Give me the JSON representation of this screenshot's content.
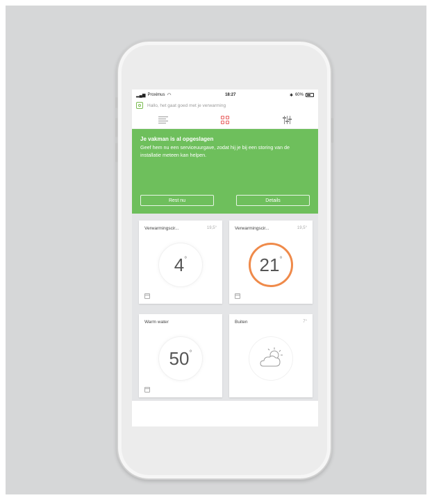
{
  "status": {
    "carrier": "Proximus",
    "time": "18:27",
    "battery": "60%"
  },
  "greeting": "Hallo, het gaat goed met je verwarming",
  "banner": {
    "title": "Je vakman is al opgeslagen",
    "text": "Geef hem nu een serviceuurgave, zodat hij je bij een storing van de installatie meteen kan helpen.",
    "btn_left": "Rest nu",
    "btn_right": "Details"
  },
  "tiles": [
    {
      "name": "Verwarmingscir...",
      "temp": "19,5°",
      "value": "4",
      "deg": "°"
    },
    {
      "name": "Verwarmingscir...",
      "temp": "19,5°",
      "value": "21",
      "deg": "°"
    },
    {
      "name": "Warm water",
      "value": "50",
      "deg": "°"
    },
    {
      "name": "Buiten",
      "temp": "7°"
    }
  ],
  "colors": {
    "banner": "#6ebf5c",
    "accent": "#e85c5c",
    "dial_active": "#ef8a4a"
  },
  "icons": {
    "menu": "hamburger-icon",
    "dashboard": "grid-icon",
    "settings": "sliders-icon",
    "weather": "partly-cloudy-icon"
  }
}
